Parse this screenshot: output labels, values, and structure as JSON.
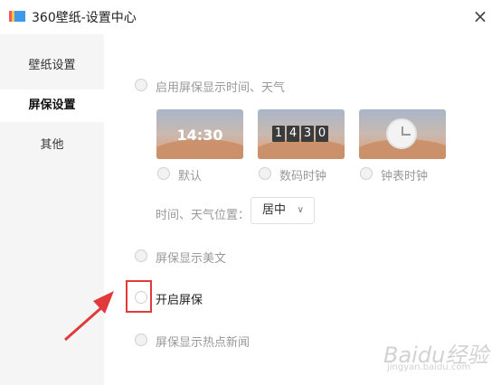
{
  "window": {
    "title": "360壁纸-设置中心",
    "close_icon": "×"
  },
  "sidebar": {
    "items": [
      {
        "label": "壁纸设置",
        "active": false
      },
      {
        "label": "屏保设置",
        "active": true
      },
      {
        "label": "其他",
        "active": false
      }
    ]
  },
  "screensaver": {
    "show_time_weather": {
      "label": "启用屏保显示时间、天气",
      "checked": false,
      "enabled": false
    },
    "styles": [
      {
        "label": "默认",
        "preview": "14:30",
        "checked": false
      },
      {
        "label": "数码时钟",
        "preview_digits": [
          "1",
          "4",
          "3",
          "0"
        ],
        "checked": false
      },
      {
        "label": "钟表时钟",
        "checked": false
      }
    ],
    "position": {
      "label": "时间、天气位置：",
      "value": "居中"
    },
    "show_article": {
      "label": "屏保显示美文",
      "checked": false,
      "enabled": false
    },
    "enable_screensaver": {
      "label": "开启屏保",
      "checked": false,
      "enabled": true
    },
    "show_news": {
      "label": "屏保显示热点新闻",
      "checked": false,
      "enabled": false
    }
  },
  "watermark": {
    "text": "Baidu经验",
    "url": "jingyan.baidu.com"
  },
  "colors": {
    "highlight": "#e23a3a",
    "sidebar_bg": "#f5f5f5",
    "disabled_text": "#999999"
  }
}
